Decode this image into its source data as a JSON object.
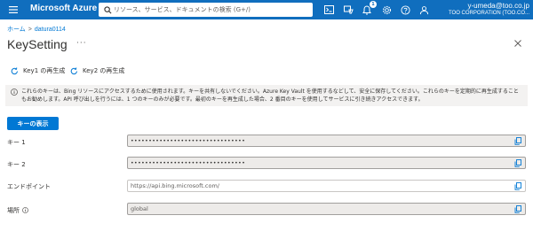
{
  "header": {
    "brand": "Microsoft Azure",
    "search_placeholder": "リソース、サービス、ドキュメントの検索 (G+/)",
    "notification_count": "1",
    "user_email": "y-umeda@too.co.jp",
    "user_org": "TOO CORPORATION (TOO.CO..."
  },
  "breadcrumb": {
    "home": "ホーム",
    "separator": ">",
    "resource": "datura0114"
  },
  "page": {
    "title": "KeySetting",
    "more": "···"
  },
  "toolbar": {
    "regen_key1": "Key1 の再生成",
    "regen_key2": "Key2 の再生成"
  },
  "info": {
    "text": "これらのキーは、Bing リソースにアクセスするために使用されます。キーを共有しないでください。Azure Key Vault を使用するなどして、安全に保存してください。これらのキーを定期的に再生成することもお勧めします。API 呼び出しを行うには、1 つのキーのみが必要です。最初のキーを再生成した場合、2 番目のキーを使用してサービスに引き続きアクセスできます。"
  },
  "show_keys_button": "キーの表示",
  "fields": {
    "key1": {
      "label": "キー 1",
      "value": "••••••••••••••••••••••••••••••••"
    },
    "key2": {
      "label": "キー 2",
      "value": "••••••••••••••••••••••••••••••••"
    },
    "endpoint": {
      "label": "エンドポイント",
      "value": "https://api.bing.microsoft.com/"
    },
    "location": {
      "label": "場所",
      "value": "global"
    }
  },
  "colors": {
    "topbar": "#106ebe",
    "accent": "#0078d4",
    "info_bg": "#f3f2f1",
    "field_bg": "#edebe9"
  }
}
